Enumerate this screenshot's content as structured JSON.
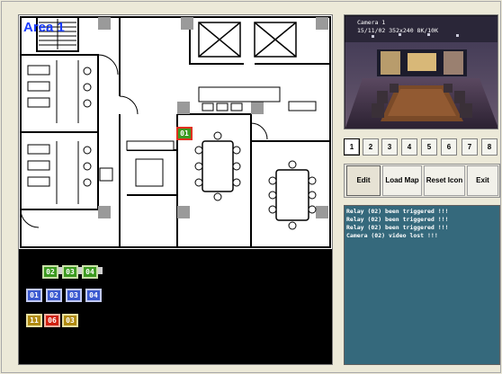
{
  "map": {
    "area_title": "Area 1",
    "placed_icon_label": "01"
  },
  "tray": {
    "relays": [
      "02",
      "03",
      "04"
    ],
    "cameras": [
      "01",
      "02",
      "03",
      "04"
    ],
    "sensors": [
      "11",
      "06",
      "03"
    ]
  },
  "camera_view": {
    "osd_line1": "Camera 1",
    "osd_line2": "15/11/02 352x240 8K/10K"
  },
  "channels": [
    "1",
    "2",
    "3",
    "4",
    "5",
    "6",
    "7",
    "8"
  ],
  "actions": {
    "edit": "Edit",
    "load_map": "Load Map",
    "reset_icon": "Reset Icon",
    "exit": "Exit"
  },
  "event_log": [
    "Relay (02) been triggered !!!",
    "Relay (02) been triggered !!!",
    "Relay (02) been triggered !!!",
    "Camera (02) video lost !!!"
  ],
  "colors": {
    "area_title": "#1a3cff",
    "log_background": "#35697c",
    "window_background": "#ece9d8"
  }
}
